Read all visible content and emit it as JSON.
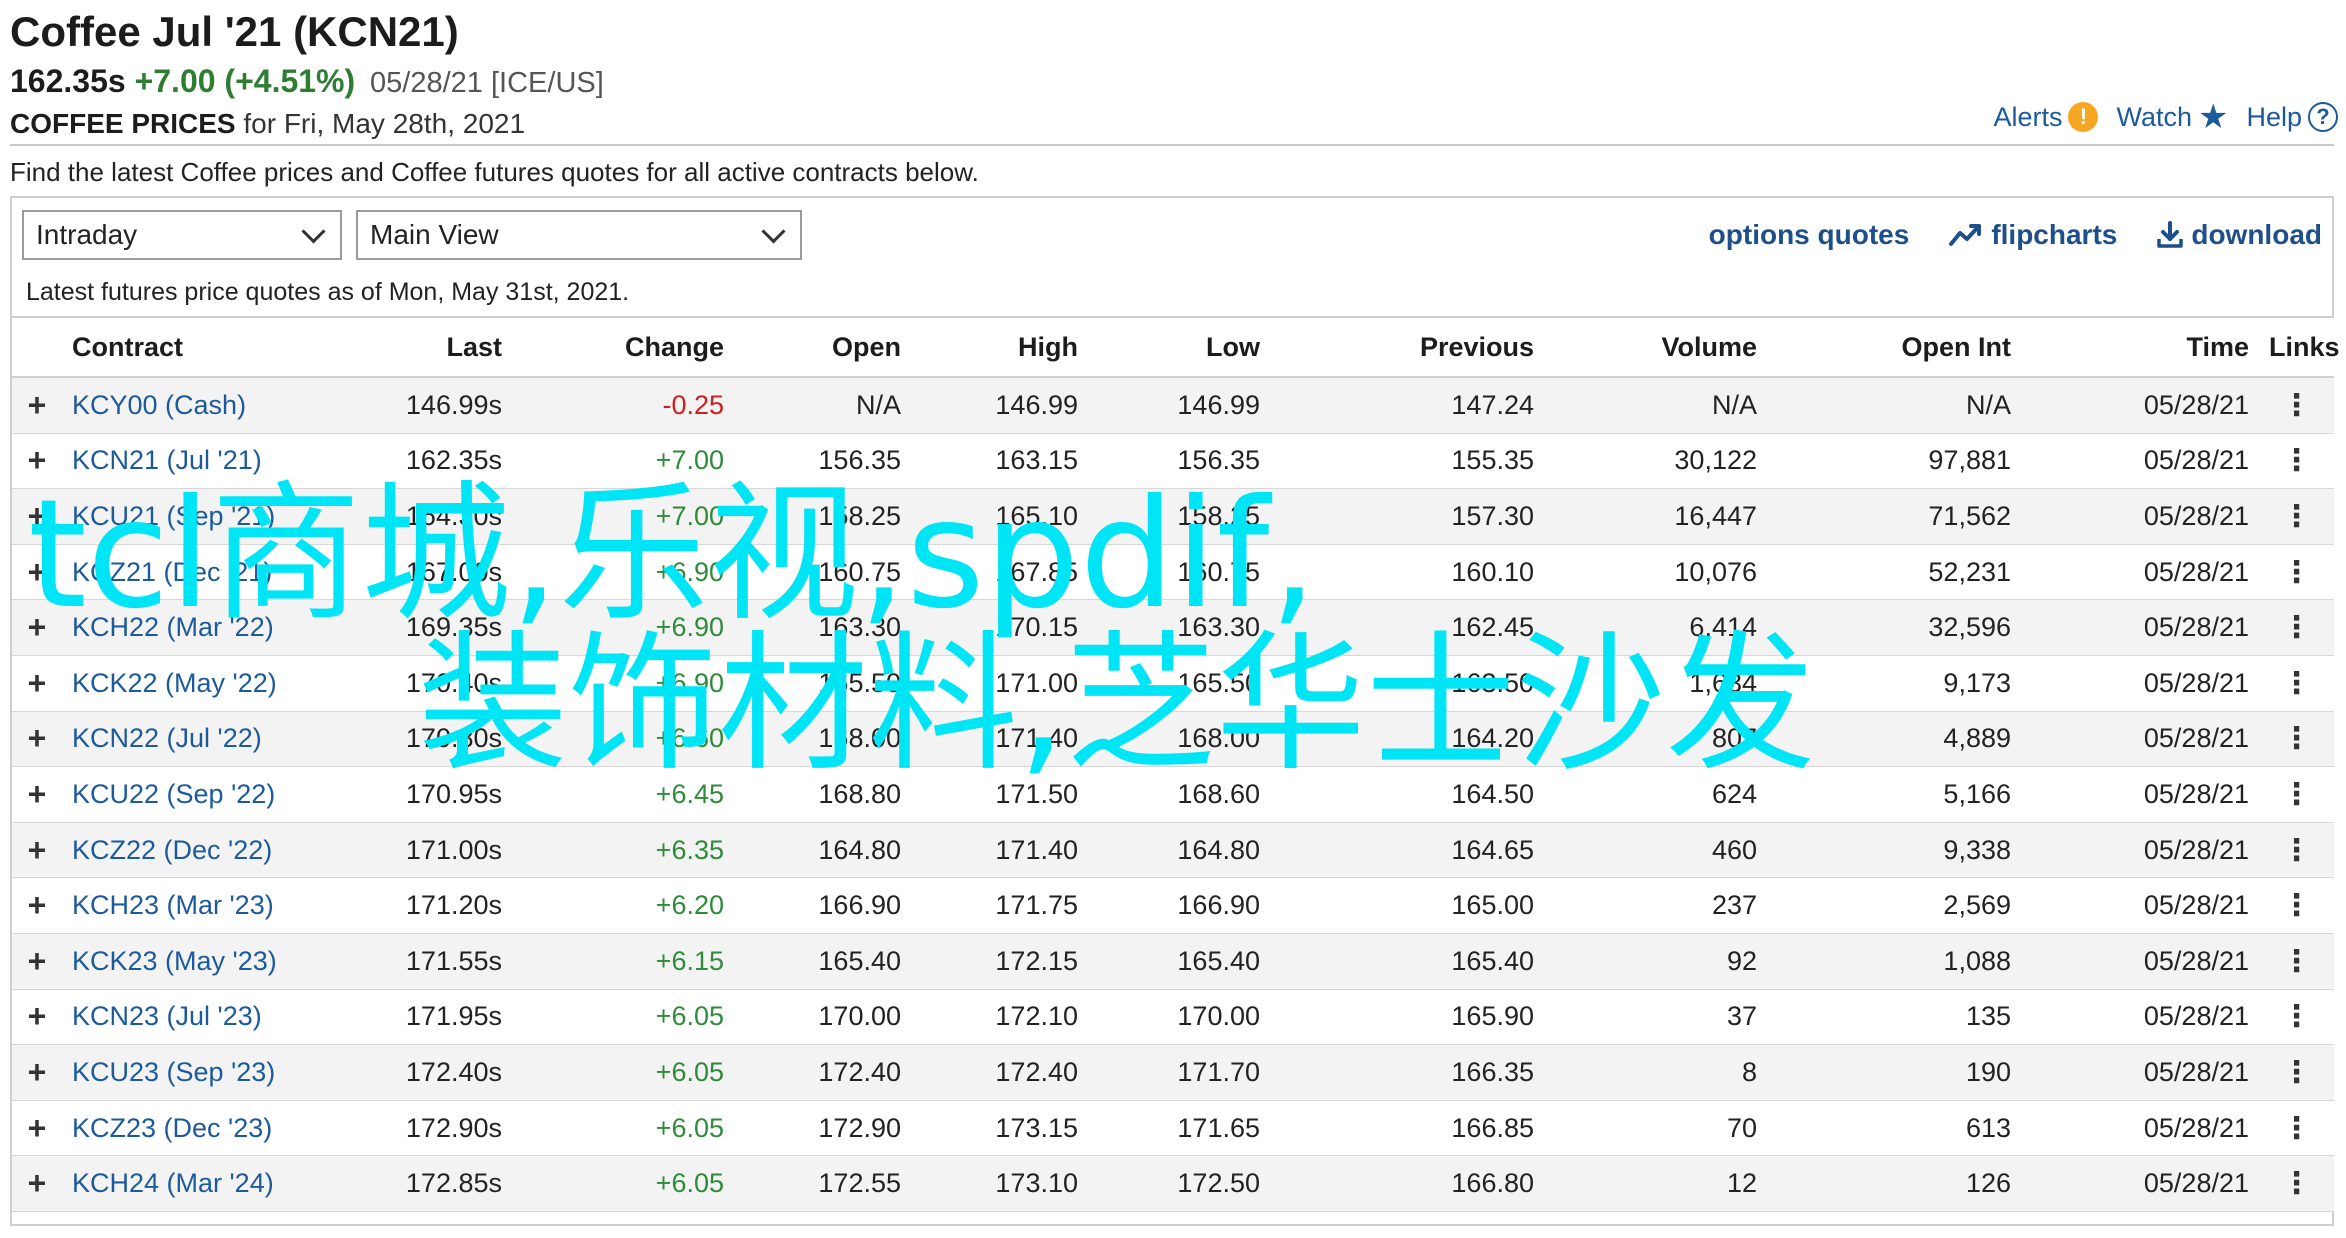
{
  "header": {
    "title": "Coffee Jul '21 (KCN21)",
    "last_price": "162.35s",
    "change": "+7.00 (+4.51%)",
    "meta": "05/28/21 [ICE/US]",
    "sub_label": "COFFEE PRICES",
    "sub_text": " for Fri, May 28th, 2021"
  },
  "top_links": {
    "alerts": "Alerts",
    "watch": "Watch",
    "help": "Help"
  },
  "intro": "Find the latest Coffee prices and Coffee futures quotes for all active contracts below.",
  "controls": {
    "period_select": "Intraday",
    "view_select": "Main View",
    "options_quotes": "options quotes",
    "flipcharts": "flipcharts",
    "download": "download"
  },
  "as_of": "Latest futures price quotes as of Mon, May 31st, 2021.",
  "table": {
    "headers": {
      "contract": "Contract",
      "last": "Last",
      "change": "Change",
      "open": "Open",
      "high": "High",
      "low": "Low",
      "previous": "Previous",
      "volume": "Volume",
      "open_int": "Open Int",
      "time": "Time",
      "links": "Links"
    },
    "rows": [
      {
        "contract": "KCY00 (Cash)",
        "last": "146.99s",
        "change": "-0.25",
        "open": "N/A",
        "high": "146.99",
        "low": "146.99",
        "previous": "147.24",
        "volume": "N/A",
        "open_int": "N/A",
        "time": "05/28/21"
      },
      {
        "contract": "KCN21 (Jul '21)",
        "last": "162.35s",
        "change": "+7.00",
        "open": "156.35",
        "high": "163.15",
        "low": "156.35",
        "previous": "155.35",
        "volume": "30,122",
        "open_int": "97,881",
        "time": "05/28/21"
      },
      {
        "contract": "KCU21 (Sep '21)",
        "last": "164.30s",
        "change": "+7.00",
        "open": "158.25",
        "high": "165.10",
        "low": "158.25",
        "previous": "157.30",
        "volume": "16,447",
        "open_int": "71,562",
        "time": "05/28/21"
      },
      {
        "contract": "KCZ21 (Dec '21)",
        "last": "167.00s",
        "change": "+6.90",
        "open": "160.75",
        "high": "167.85",
        "low": "160.75",
        "previous": "160.10",
        "volume": "10,076",
        "open_int": "52,231",
        "time": "05/28/21"
      },
      {
        "contract": "KCH22 (Mar '22)",
        "last": "169.35s",
        "change": "+6.90",
        "open": "163.30",
        "high": "170.15",
        "low": "163.30",
        "previous": "162.45",
        "volume": "6,414",
        "open_int": "32,596",
        "time": "05/28/21"
      },
      {
        "contract": "KCK22 (May '22)",
        "last": "170.40s",
        "change": "+6.90",
        "open": "165.50",
        "high": "171.00",
        "low": "165.50",
        "previous": "163.50",
        "volume": "1,634",
        "open_int": "9,173",
        "time": "05/28/21"
      },
      {
        "contract": "KCN22 (Jul '22)",
        "last": "170.80s",
        "change": "+6.60",
        "open": "168.00",
        "high": "171.40",
        "low": "168.00",
        "previous": "164.20",
        "volume": "807",
        "open_int": "4,889",
        "time": "05/28/21"
      },
      {
        "contract": "KCU22 (Sep '22)",
        "last": "170.95s",
        "change": "+6.45",
        "open": "168.80",
        "high": "171.50",
        "low": "168.60",
        "previous": "164.50",
        "volume": "624",
        "open_int": "5,166",
        "time": "05/28/21"
      },
      {
        "contract": "KCZ22 (Dec '22)",
        "last": "171.00s",
        "change": "+6.35",
        "open": "164.80",
        "high": "171.40",
        "low": "164.80",
        "previous": "164.65",
        "volume": "460",
        "open_int": "9,338",
        "time": "05/28/21"
      },
      {
        "contract": "KCH23 (Mar '23)",
        "last": "171.20s",
        "change": "+6.20",
        "open": "166.90",
        "high": "171.75",
        "low": "166.90",
        "previous": "165.00",
        "volume": "237",
        "open_int": "2,569",
        "time": "05/28/21"
      },
      {
        "contract": "KCK23 (May '23)",
        "last": "171.55s",
        "change": "+6.15",
        "open": "165.40",
        "high": "172.15",
        "low": "165.40",
        "previous": "165.40",
        "volume": "92",
        "open_int": "1,088",
        "time": "05/28/21"
      },
      {
        "contract": "KCN23 (Jul '23)",
        "last": "171.95s",
        "change": "+6.05",
        "open": "170.00",
        "high": "172.10",
        "low": "170.00",
        "previous": "165.90",
        "volume": "37",
        "open_int": "135",
        "time": "05/28/21"
      },
      {
        "contract": "KCU23 (Sep '23)",
        "last": "172.40s",
        "change": "+6.05",
        "open": "172.40",
        "high": "172.40",
        "low": "171.70",
        "previous": "166.35",
        "volume": "8",
        "open_int": "190",
        "time": "05/28/21"
      },
      {
        "contract": "KCZ23 (Dec '23)",
        "last": "172.90s",
        "change": "+6.05",
        "open": "172.90",
        "high": "173.15",
        "low": "171.65",
        "previous": "166.85",
        "volume": "70",
        "open_int": "613",
        "time": "05/28/21"
      },
      {
        "contract": "KCH24 (Mar '24)",
        "last": "172.85s",
        "change": "+6.05",
        "open": "172.55",
        "high": "173.10",
        "low": "172.50",
        "previous": "166.80",
        "volume": "12",
        "open_int": "126",
        "time": "05/28/21"
      }
    ]
  },
  "watermark": {
    "line1": "tcl商城,乐视,spdif,",
    "line2": "装饰材料,芝华士沙发"
  },
  "colors": {
    "link_blue": "#1d5a9c",
    "positive_green": "#2e8b3a",
    "negative_red": "#cc1f1f",
    "watermark_cyan": "#00e5f5",
    "alert_orange": "#f5a623"
  }
}
